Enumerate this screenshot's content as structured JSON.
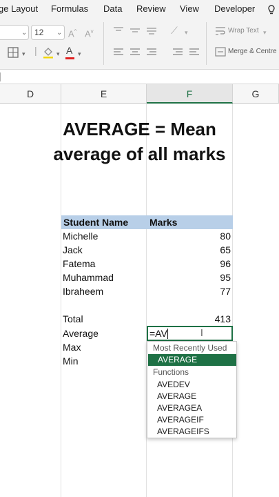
{
  "ribbon_tabs": [
    "ge Layout",
    "Formulas",
    "Data",
    "Review",
    "View",
    "Developer"
  ],
  "ribbon": {
    "font_size": "12",
    "wrap_text_label": "Wrap Text",
    "merge_label": "Merge & Centre"
  },
  "columns": [
    "D",
    "E",
    "F",
    "G"
  ],
  "selected_column": "F",
  "headline": {
    "line1": "AVERAGE = Mean",
    "line2": "average of all marks"
  },
  "table": {
    "headers": [
      "Student Name",
      "Marks"
    ],
    "rows": [
      {
        "name": "Michelle",
        "mark": "80"
      },
      {
        "name": "Jack",
        "mark": "65"
      },
      {
        "name": "Fatema",
        "mark": "96"
      },
      {
        "name": "Muhammad",
        "mark": "95"
      },
      {
        "name": "Ibraheem",
        "mark": "77"
      }
    ]
  },
  "summary": {
    "total_label": "Total",
    "total_value": "413",
    "average_label": "Average",
    "max_label": "Max",
    "min_label": "Min"
  },
  "active_cell_text": "=AV",
  "autocomplete": {
    "recent_header": "Most Recently Used",
    "recent_selected": "AVERAGE",
    "functions_header": "Functions",
    "functions": [
      "AVEDEV",
      "AVERAGE",
      "AVERAGEA",
      "AVERAGEIF",
      "AVERAGEIFS"
    ]
  },
  "colors": {
    "accent_green": "#1e7145",
    "table_header_fill": "#b8cfe8"
  }
}
